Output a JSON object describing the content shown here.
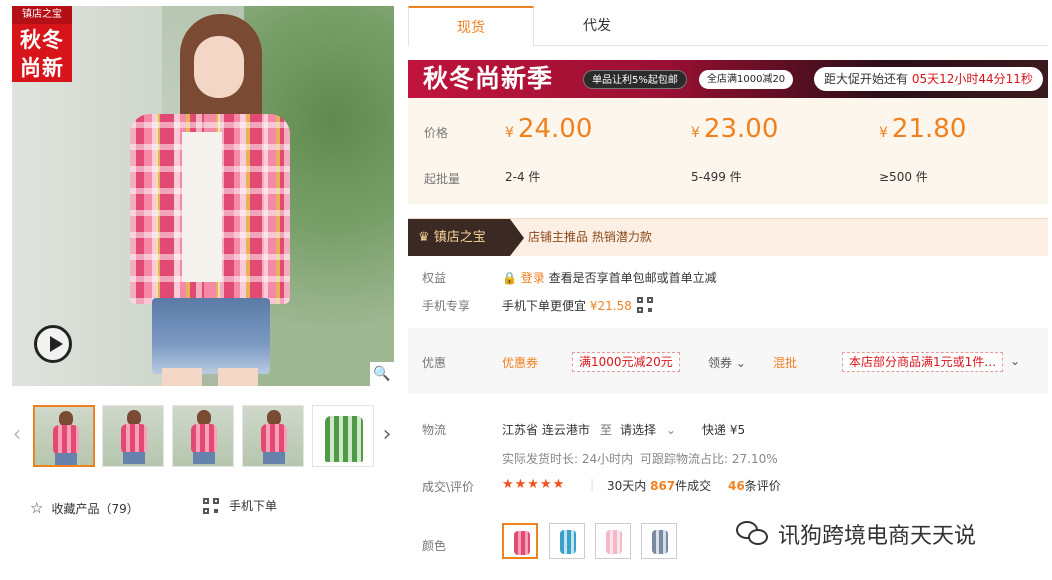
{
  "promo_badge": {
    "store_tag": "镇店之宝",
    "season_text": "秋冬尚新"
  },
  "gallery": {
    "thumbnails": [
      "thumb-1",
      "thumb-2",
      "thumb-3",
      "thumb-4",
      "thumb-5"
    ],
    "favorite_label": "收藏产品（79）",
    "mobile_order_label": "手机下单"
  },
  "tabs": {
    "spot": "现货",
    "dropship": "代发"
  },
  "banner": {
    "title": "秋冬尚新季",
    "pill_1": "单品让利5%起包邮",
    "pill_2": "全店满1000减20",
    "countdown_prefix": "距大促开始还有 ",
    "countdown_time": "05天12小时44分11秒"
  },
  "price_panel": {
    "price_label": "价格",
    "min_qty_label": "起批量",
    "currency": "¥",
    "tiers": [
      {
        "price": "24.00",
        "qty": "2-4 件"
      },
      {
        "price": "23.00",
        "qty": "5-499 件"
      },
      {
        "price": "21.80",
        "qty": "≥500 件"
      }
    ]
  },
  "treasure": {
    "badge": "镇店之宝",
    "text": "店铺主推品  热销潜力款"
  },
  "benefits": {
    "label": "权益",
    "login_link": "登录",
    "text": "查看是否享首单包邮或首单立减"
  },
  "mobile_exclusive": {
    "label": "手机专享",
    "text": "手机下单更便宜",
    "price": "¥21.58"
  },
  "discount": {
    "label": "优惠",
    "coupon_label": "优惠券",
    "coupon_value": "满1000元减20元",
    "get_coupon": "领券",
    "mixed_label": "混批",
    "mixed_value": "本店部分商品满1元或1件…"
  },
  "logistics": {
    "label": "物流",
    "from": "江苏省 连云港市",
    "to_word": "至",
    "select": "请选择",
    "express": "快递 ¥5",
    "ship_time": "实际发货时长: 24小时内",
    "trace_rate": "可跟踪物流占比: 27.10%"
  },
  "reviews": {
    "label": "成交\\评价",
    "stars": "★★★★★",
    "deals_prefix": "30天内 ",
    "deals_count": "867",
    "deals_suffix": "件成交",
    "review_count": "46",
    "review_suffix": "条评价"
  },
  "colors": {
    "label": "颜色",
    "swatches": [
      "#e24a74",
      "#3aa0c8",
      "#f5b8c8",
      "#7a8aa0"
    ]
  },
  "watermark": "讯狗跨境电商天天说",
  "accent": "#f0811f",
  "brand_red": "#d8141b"
}
